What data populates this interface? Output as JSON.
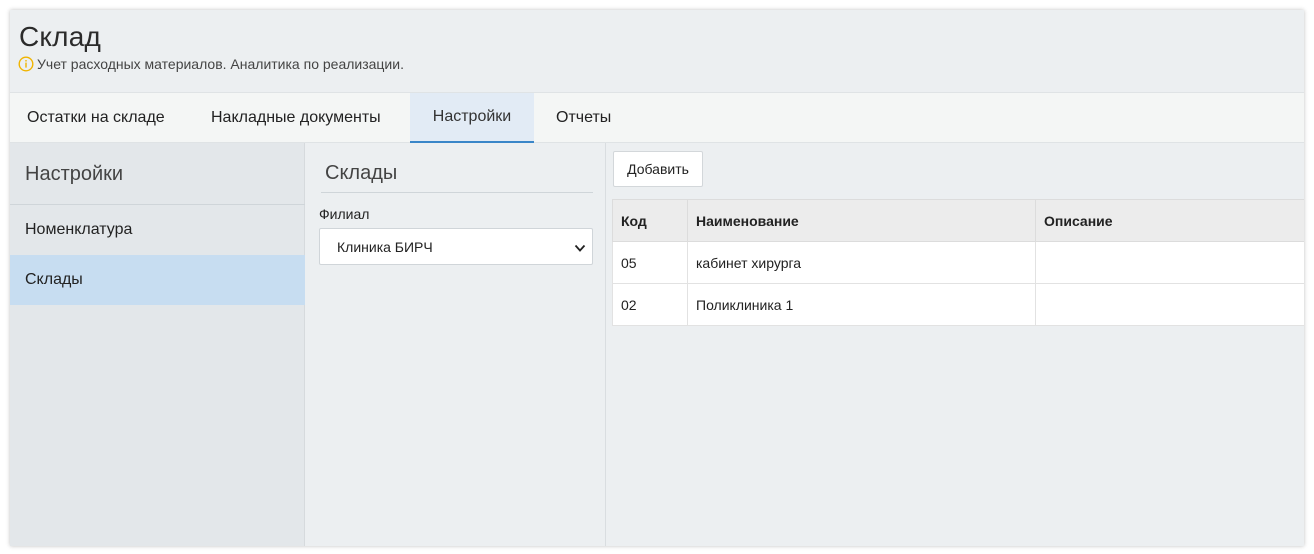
{
  "header": {
    "title": "Склад",
    "subtitle": "Учет расходных материалов. Аналитика по реализации.",
    "info_icon": "info-circle-icon",
    "info_icon_color": "#f0b400"
  },
  "tabs": [
    {
      "label": "Остатки на складе",
      "active": false
    },
    {
      "label": "Накладные документы",
      "active": false
    },
    {
      "label": "Настройки",
      "active": true
    },
    {
      "label": "Отчеты",
      "active": false
    }
  ],
  "sidebar": {
    "title": "Настройки",
    "items": [
      {
        "label": "Номенклатура",
        "active": false
      },
      {
        "label": "Склады",
        "active": true
      }
    ]
  },
  "middle": {
    "title": "Склады",
    "filial_label": "Филиал",
    "filial_selected": "Клиника БИРЧ"
  },
  "right": {
    "add_button": "Добавить",
    "table": {
      "columns": [
        "Код",
        "Наименование",
        "Описание"
      ],
      "rows": [
        [
          "05",
          "кабинет хирурга",
          ""
        ],
        [
          "02",
          "Поликлиника 1",
          ""
        ]
      ]
    }
  },
  "colors": {
    "active_tab_bg": "#e2ebf5",
    "active_tab_underline": "#3a86c8",
    "active_sidebar_bg": "#c7ddf1"
  }
}
